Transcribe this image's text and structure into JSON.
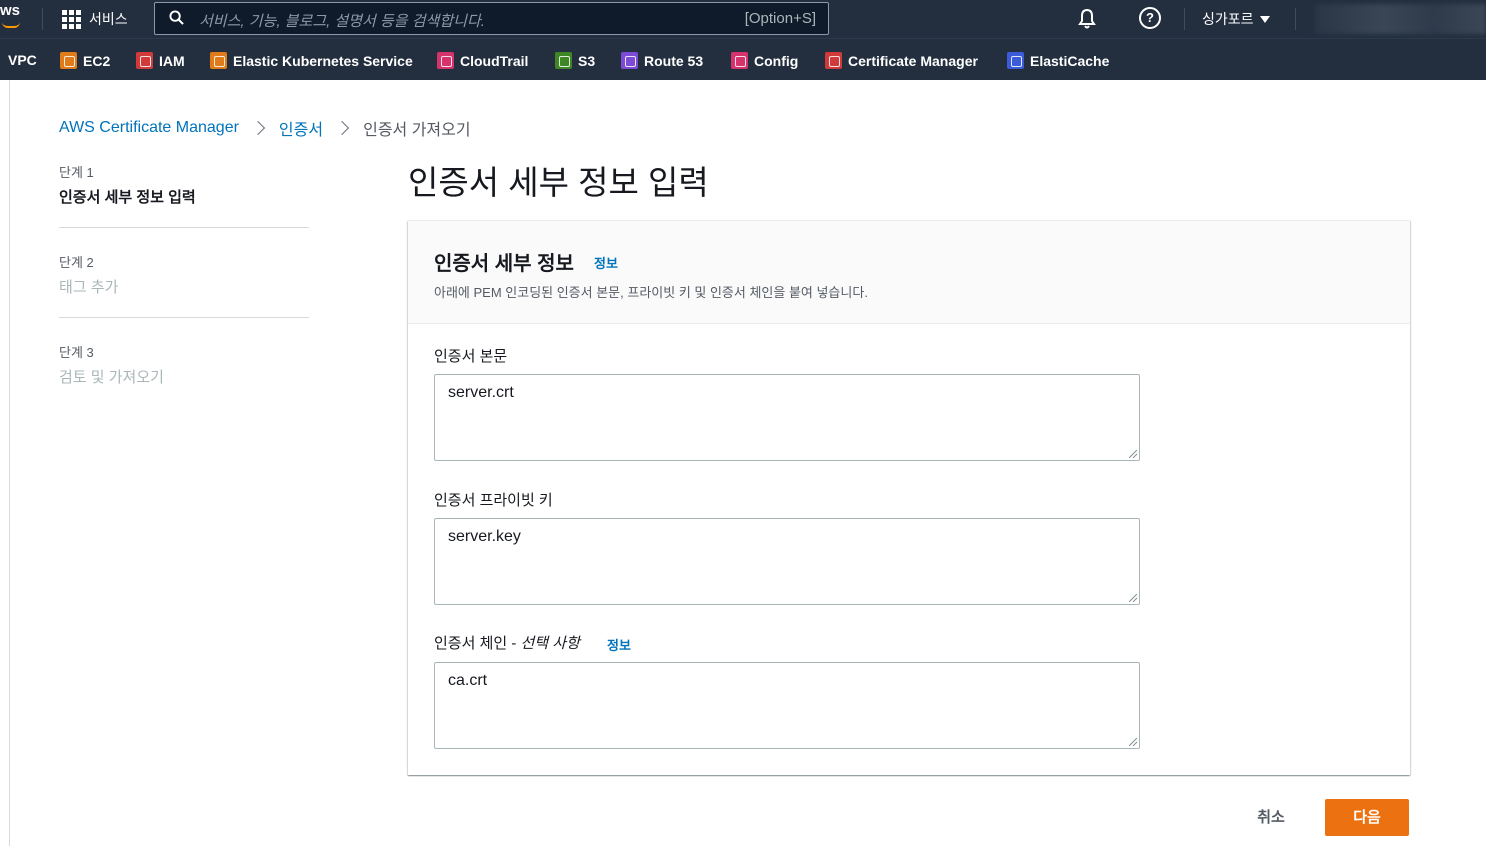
{
  "topnav": {
    "logo_text": "ws",
    "services_label": "서비스",
    "search_placeholder": "서비스, 기능, 블로그, 설명서 등을 검색합니다.",
    "search_shortcut": "[Option+S]",
    "region_label": "싱가포르"
  },
  "favorites": [
    {
      "label": "VPC",
      "icon": "vpc-icon",
      "color": "#232f3e"
    },
    {
      "label": "EC2",
      "icon": "ec2-icon",
      "color": "#e07b1a"
    },
    {
      "label": "IAM",
      "icon": "iam-icon",
      "color": "#d13a3a"
    },
    {
      "label": "Elastic Kubernetes Service",
      "icon": "eks-icon",
      "color": "#e07b1a"
    },
    {
      "label": "CloudTrail",
      "icon": "cloudtrail-icon",
      "color": "#d6336c"
    },
    {
      "label": "S3",
      "icon": "s3-icon",
      "color": "#3f8624"
    },
    {
      "label": "Route 53",
      "icon": "route53-icon",
      "color": "#7d4bd6"
    },
    {
      "label": "Config",
      "icon": "config-icon",
      "color": "#d6336c"
    },
    {
      "label": "Certificate Manager",
      "icon": "certificate-manager-icon",
      "color": "#d13a3a"
    },
    {
      "label": "ElastiCache",
      "icon": "elasticache-icon",
      "color": "#3b5bdb"
    }
  ],
  "breadcrumb": {
    "root": "AWS Certificate Manager",
    "parent": "인증서",
    "current": "인증서 가져오기"
  },
  "steps": [
    {
      "label": "단계 1",
      "title": "인증서 세부 정보 입력"
    },
    {
      "label": "단계 2",
      "title": "태그 추가"
    },
    {
      "label": "단계 3",
      "title": "검토 및 가져오기"
    }
  ],
  "page_title": "인증서 세부 정보 입력",
  "panel": {
    "title": "인증서 세부 정보",
    "info": "정보",
    "description": "아래에 PEM 인코딩된 인증서 본문, 프라이빗 키 및 인증서 체인을 붙여 넣습니다."
  },
  "fields": {
    "body_label": "인증서 본문",
    "body_value": "server.crt",
    "key_label": "인증서 프라이빗 키",
    "key_value": "server.key",
    "chain_label": "인증서 체인 - ",
    "chain_optional": "선택 사항",
    "chain_info": "정보",
    "chain_value": "ca.crt"
  },
  "actions": {
    "cancel": "취소",
    "next": "다음"
  }
}
